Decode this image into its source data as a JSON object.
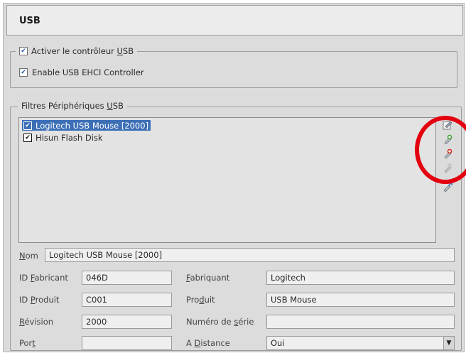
{
  "title": "USB",
  "controller": {
    "enable_label_pre": "Activer le contrôleur ",
    "enable_label_key": "U",
    "enable_label_post": "SB",
    "enable_checked": true,
    "ehci_label": "Enable USB EHCI Controller",
    "ehci_checked": true
  },
  "filters": {
    "legend_pre": "Filtres Périphériques ",
    "legend_key": "U",
    "legend_post": "SB",
    "items": [
      {
        "label": "Logitech USB Mouse [2000]",
        "checked": true,
        "selected": true
      },
      {
        "label": "Hisun Flash Disk",
        "checked": true,
        "selected": false
      }
    ],
    "tools": [
      "edit-filter-icon",
      "add-filter-icon",
      "add-from-device-icon",
      "remove-filter-icon",
      "move-filter-icon"
    ]
  },
  "details": {
    "name_label_key": "N",
    "name_label_rest": "om",
    "name_value": "Logitech USB Mouse [2000]",
    "vendor_id_label_pre": "ID ",
    "vendor_id_label_key": "F",
    "vendor_id_label_post": "abricant",
    "vendor_id_value": "046D",
    "product_id_label_pre": "ID ",
    "product_id_label_key": "P",
    "product_id_label_post": "roduit",
    "product_id_value": "C001",
    "revision_label_key": "R",
    "revision_label_rest": "évision",
    "revision_value": "2000",
    "port_label_pre": "Por",
    "port_label_key": "t",
    "port_value": "",
    "manufacturer_label_key": "F",
    "manufacturer_label_rest": "abriquant",
    "manufacturer_value": "Logitech",
    "product_label_pre": "Pro",
    "product_label_key": "d",
    "product_label_post": "uit",
    "product_value": "USB Mouse",
    "serial_label_pre": "Numéro de ",
    "serial_label_key": "s",
    "serial_label_post": "érie",
    "serial_value": "",
    "remote_label_pre": "A ",
    "remote_label_key": "D",
    "remote_label_post": "istance",
    "remote_value": "Oui"
  },
  "colors": {
    "annotation_circle": "#e3000f",
    "selection": "#3c6fb6"
  }
}
